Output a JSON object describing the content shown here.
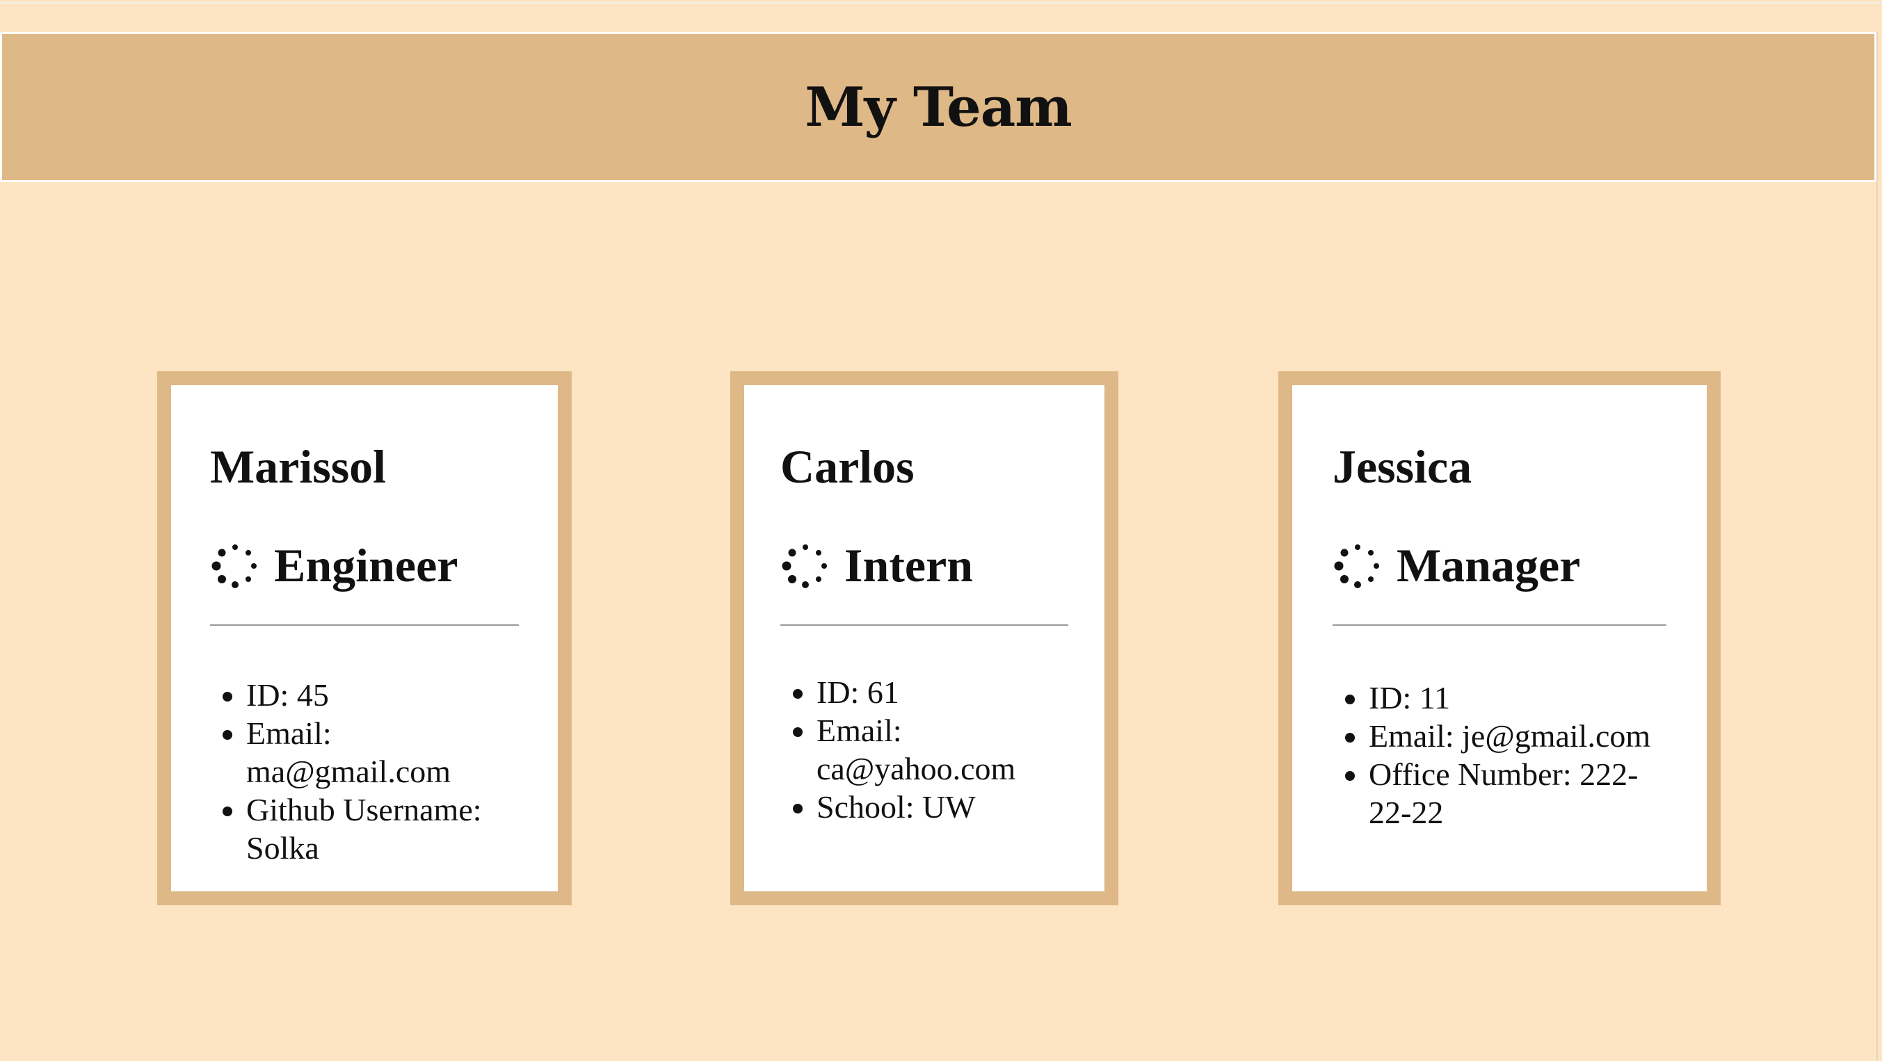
{
  "header": {
    "title": "My Team"
  },
  "icons": {
    "role": "spinner-dots-icon"
  },
  "team": [
    {
      "name": "Marissol",
      "role": "Engineer",
      "id": "ID: 45",
      "email": "Email: ma@gmail.com",
      "extra": "Github Username: Solka"
    },
    {
      "name": "Carlos",
      "role": "Intern",
      "id": "ID: 61",
      "email": "Email: ca@yahoo.com",
      "extra": "School: UW"
    },
    {
      "name": "Jessica",
      "role": "Manager",
      "id": "ID: 11",
      "email": "Email: je@gmail.com",
      "extra": "Office Number: 222-22-22"
    }
  ],
  "colors": {
    "page_background": "#fde4c2",
    "accent": "#deb887",
    "card_background": "#ffffff"
  }
}
